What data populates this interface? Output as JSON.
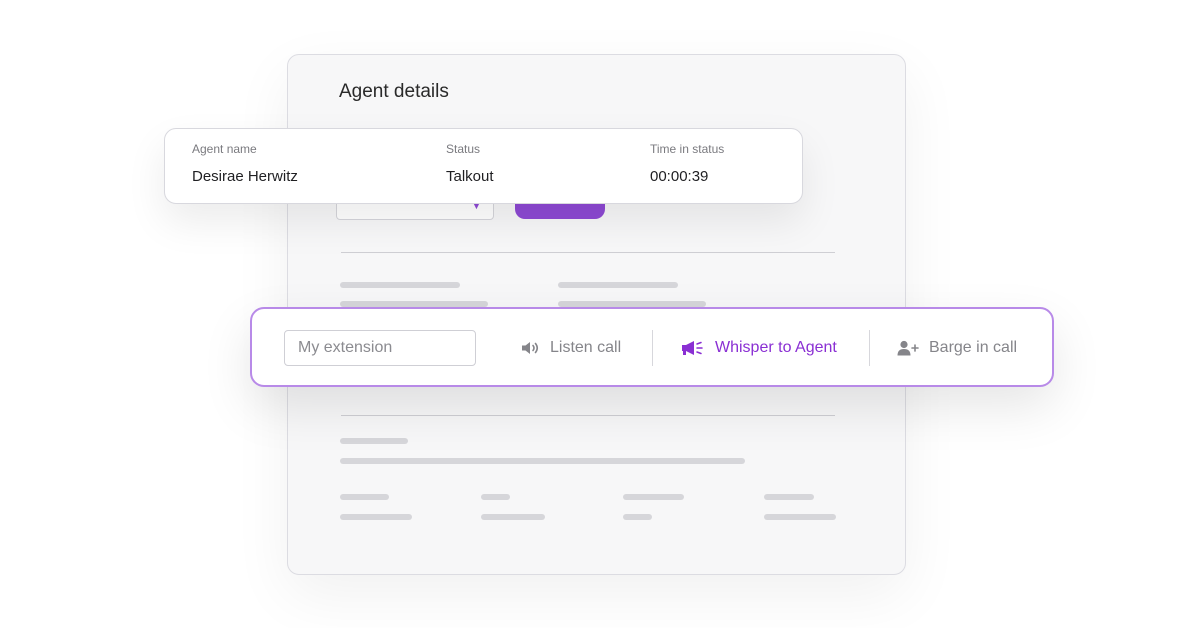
{
  "panel": {
    "title": "Agent details"
  },
  "agent_table": {
    "columns": [
      {
        "label": "Agent name",
        "value": "Desirae Herwitz"
      },
      {
        "label": "Status",
        "value": "Talkout"
      },
      {
        "label": "Time in status",
        "value": "00:00:39"
      }
    ]
  },
  "action_bar": {
    "extension_placeholder": "My extension",
    "extension_value": "",
    "actions": [
      {
        "label": "Listen call",
        "icon": "speaker-icon",
        "active": false
      },
      {
        "label": "Whisper to Agent",
        "icon": "megaphone-icon",
        "active": true
      },
      {
        "label": "Barge in call",
        "icon": "user-plus-icon",
        "active": false
      }
    ]
  },
  "colors": {
    "accent": "#8a2fd3",
    "accent_border": "#b88ae8",
    "muted_text": "#85858a",
    "skeleton": "#d6d6da"
  }
}
